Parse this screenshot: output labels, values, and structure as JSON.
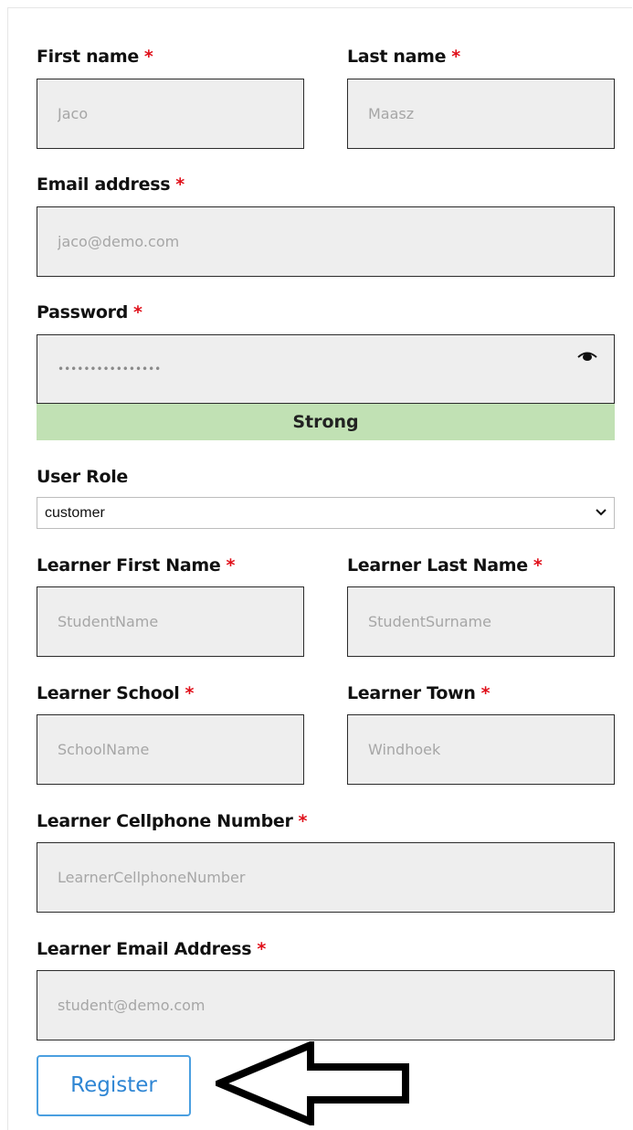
{
  "form": {
    "required_mark": "*",
    "first_name": {
      "label": "First name",
      "placeholder": "Jaco"
    },
    "last_name": {
      "label": "Last name",
      "placeholder": "Maasz"
    },
    "email": {
      "label": "Email address",
      "placeholder": "jaco@demo.com"
    },
    "password": {
      "label": "Password",
      "value": "••••••••••••••••",
      "strength": "Strong"
    },
    "user_role": {
      "label": "User Role",
      "selected": "customer"
    },
    "learner_first_name": {
      "label": "Learner First Name",
      "placeholder": "StudentName"
    },
    "learner_last_name": {
      "label": "Learner Last Name",
      "placeholder": "StudentSurname"
    },
    "learner_school": {
      "label": "Learner School",
      "placeholder": "SchoolName"
    },
    "learner_town": {
      "label": "Learner Town",
      "placeholder": "Windhoek"
    },
    "learner_cellphone": {
      "label": "Learner Cellphone Number",
      "placeholder": "LearnerCellphoneNumber"
    },
    "learner_email": {
      "label": "Learner Email Address",
      "placeholder": "student@demo.com"
    },
    "register_label": "Register"
  },
  "colors": {
    "required": "#e0101a",
    "strength_bg": "#c1e1b4",
    "button_border": "#4a9fe0",
    "button_text": "#2f86d4",
    "field_bg": "#eeeeee"
  },
  "icons": {
    "password_toggle": "eye-icon",
    "select_arrow": "chevron-down-icon",
    "pointer": "left-arrow-icon"
  }
}
